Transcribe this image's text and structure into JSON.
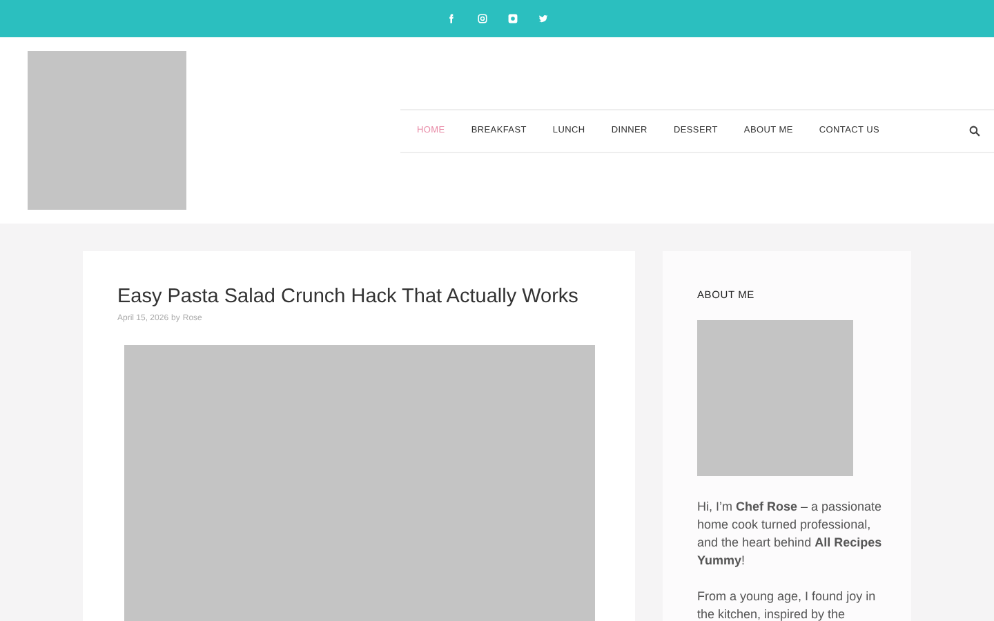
{
  "social_links": [
    {
      "kind": "facebook"
    },
    {
      "kind": "instagram"
    },
    {
      "kind": "chat"
    },
    {
      "kind": "twitter"
    }
  ],
  "nav": {
    "items": [
      {
        "label": "HOME",
        "selected": true
      },
      {
        "label": "BREAKFAST",
        "selected": false
      },
      {
        "label": "LUNCH",
        "selected": false
      },
      {
        "label": "DINNER",
        "selected": false
      },
      {
        "label": "DESSERT",
        "selected": false
      },
      {
        "label": "ABOUT ME",
        "selected": false
      },
      {
        "label": "CONTACT US",
        "selected": false
      }
    ]
  },
  "post": {
    "title": "Easy Pasta Salad Crunch Hack That Actually Works",
    "date": "April 15, 2026",
    "by": "by",
    "author": "Rose"
  },
  "sidebar": {
    "heading": "ABOUT ME",
    "paragraphs": [
      "Hi, I’m **Chef Rose** – a passionate home cook turned professional, and the heart behind **All Recipes Yummy**!",
      "From a young age, I found joy in the kitchen, inspired by the"
    ]
  }
}
